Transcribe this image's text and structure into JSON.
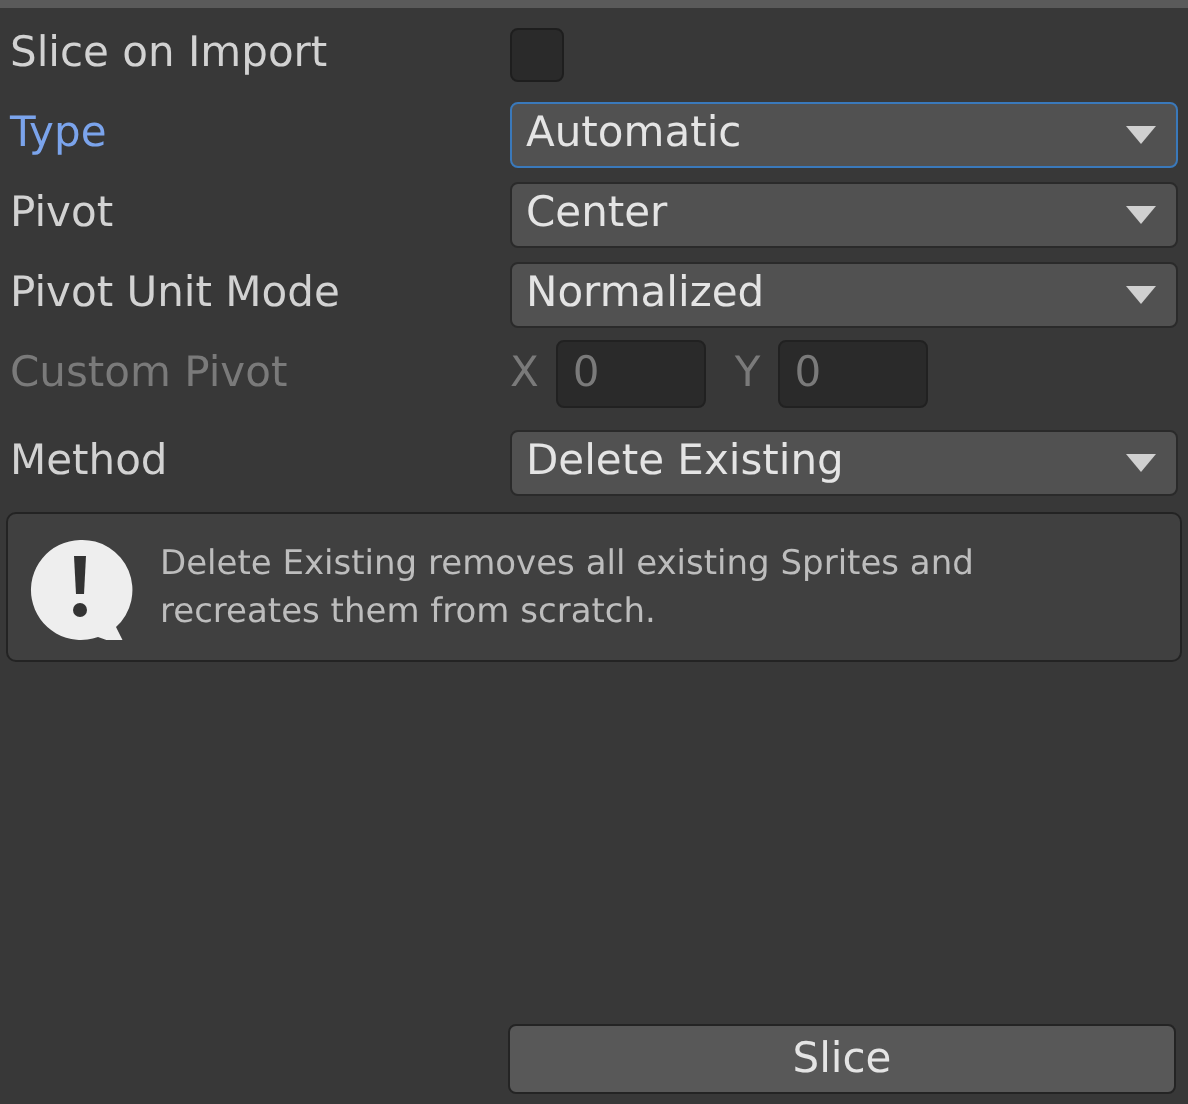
{
  "fields": [
    {
      "kind": "checkbox",
      "label": "Slice on Import",
      "checked": false,
      "focused": false,
      "disabled": false
    },
    {
      "kind": "dropdown",
      "label": "Type",
      "value": "Automatic",
      "focused": true,
      "disabled": false
    },
    {
      "kind": "dropdown",
      "label": "Pivot",
      "value": "Center",
      "focused": false,
      "disabled": false
    },
    {
      "kind": "dropdown",
      "label": "Pivot Unit Mode",
      "value": "Normalized",
      "focused": false,
      "disabled": false
    },
    {
      "kind": "vector",
      "label": "Custom Pivot",
      "components": [
        {
          "label": "X",
          "value": "0"
        },
        {
          "label": "Y",
          "value": "0"
        }
      ],
      "focused": false,
      "disabled": true
    },
    {
      "kind": "dropdown",
      "label": "Method",
      "value": "Delete Existing",
      "focused": false,
      "disabled": false
    }
  ],
  "help_box": {
    "kind": "warning",
    "text": "Delete Existing removes all existing Sprites and recreates them from scratch."
  },
  "slice_button": "Slice"
}
